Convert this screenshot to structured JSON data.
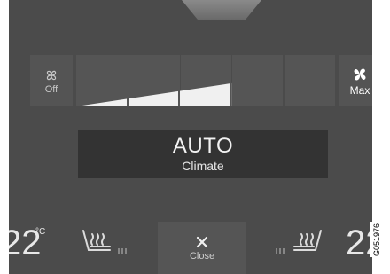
{
  "fan": {
    "off_label": "Off",
    "max_label": "Max",
    "level_fraction": 0.6,
    "segments": 5
  },
  "climate": {
    "auto_title": "AUTO",
    "auto_subtitle": "Climate"
  },
  "temperature": {
    "left_value": "22",
    "unit": "°C",
    "right_value": "22"
  },
  "close": {
    "label": "Close"
  },
  "figure_id": "G051976",
  "colors": {
    "screen_bg": "#4b4b4b",
    "auto_button_bg": "#333333",
    "wedge": "#f0f0f0"
  },
  "icons": {
    "fan_off": "fan-off-icon",
    "fan_max": "fan-max-icon",
    "seat_heat_left": "seat-heat-icon",
    "seat_heat_right": "seat-heat-icon",
    "close": "close-icon"
  }
}
